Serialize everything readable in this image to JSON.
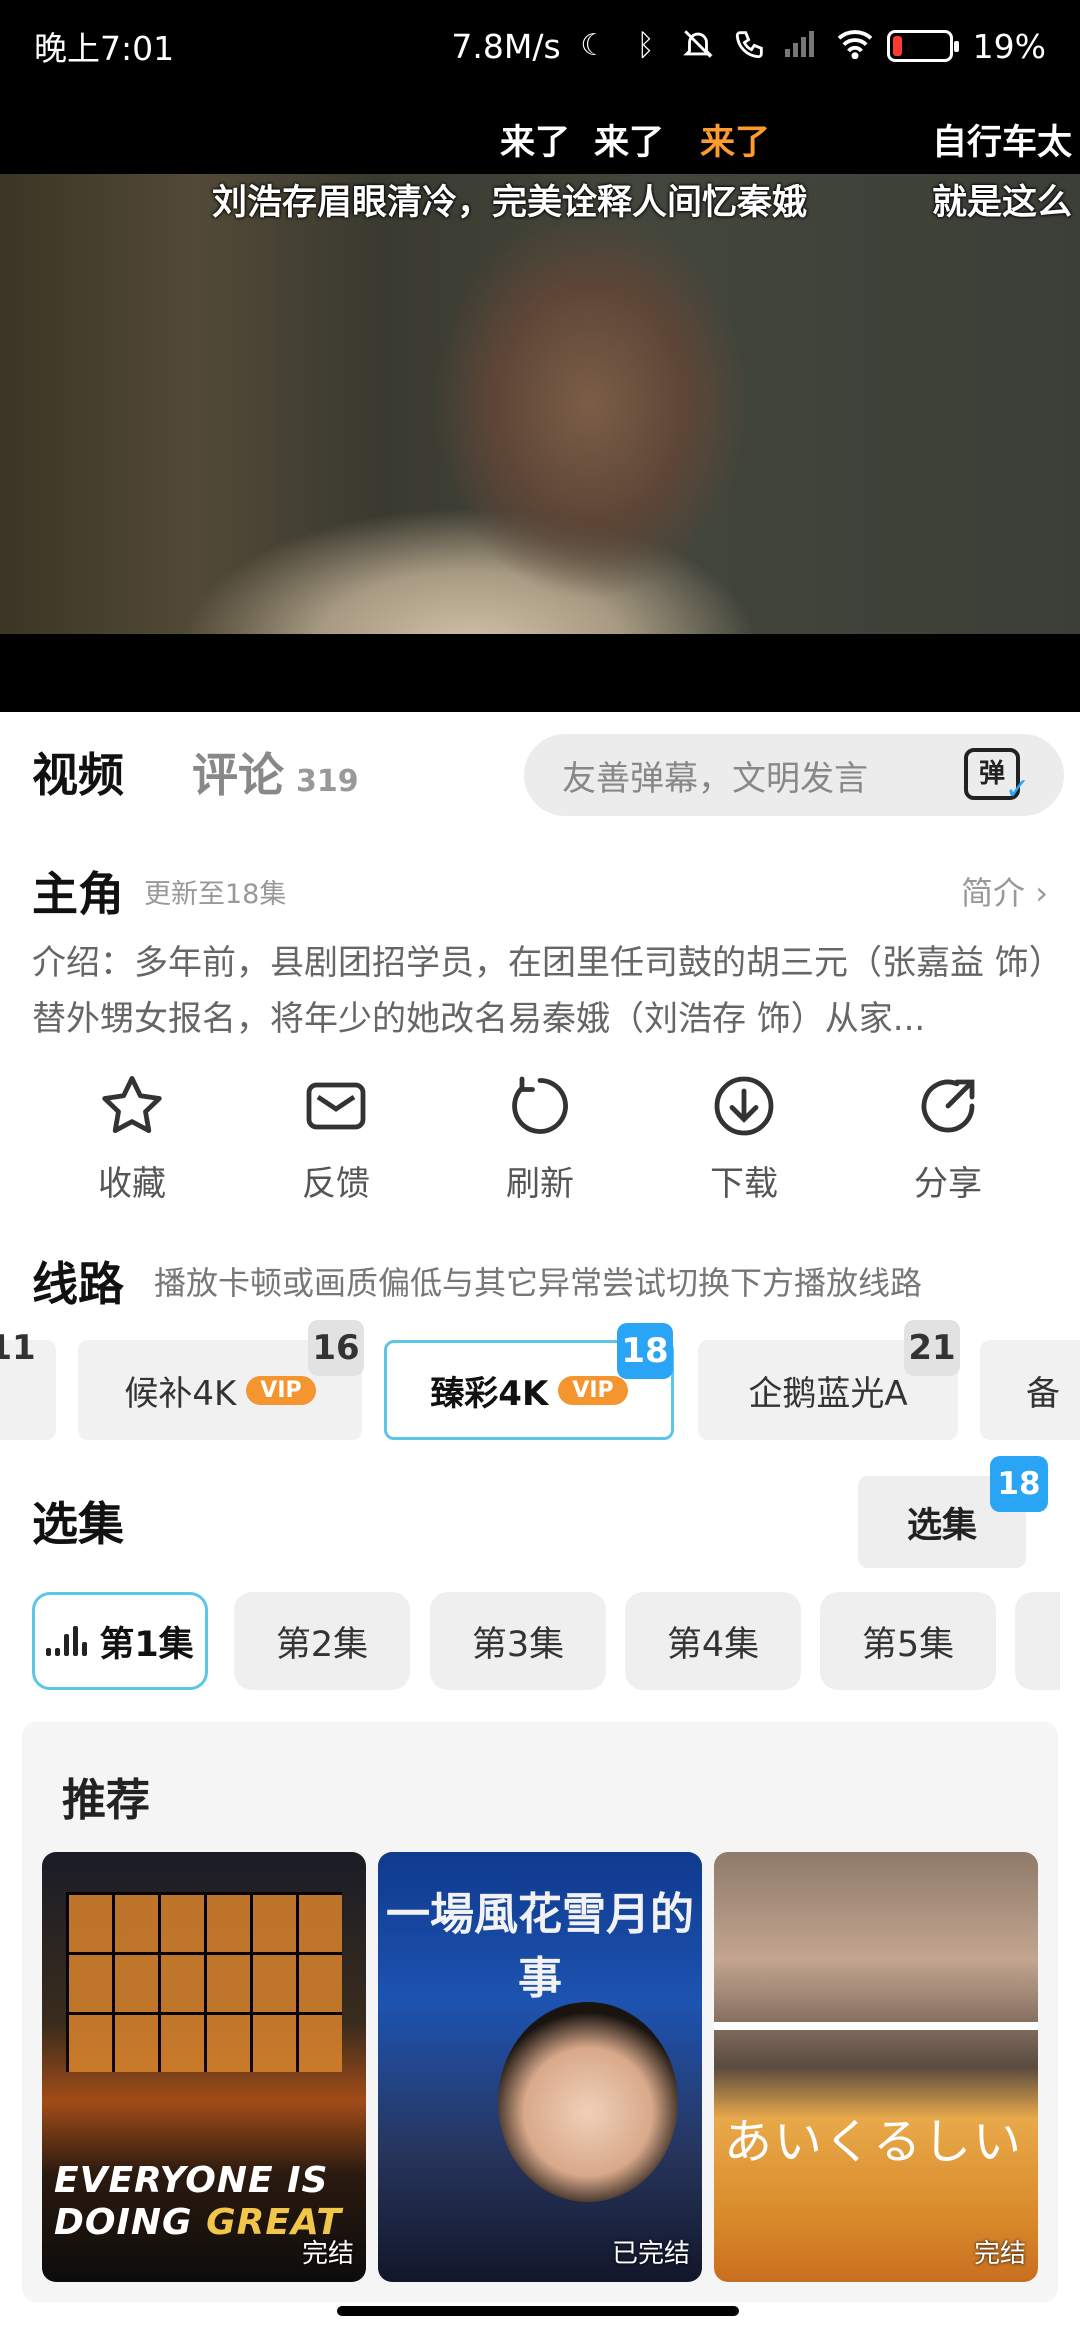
{
  "status_bar": {
    "time": "晚上7:01",
    "speed": "7.8M/s",
    "battery": "19%",
    "battery_level": 0.19,
    "icons": [
      "moon-icon",
      "bluetooth-icon",
      "mute-bell-icon",
      "call-icon",
      "signal-icon",
      "wifi-icon",
      "battery-icon"
    ]
  },
  "video": {
    "danmaku": [
      {
        "text": "来了",
        "highlight": false
      },
      {
        "text": "来了",
        "highlight": false
      },
      {
        "text": "来了",
        "highlight": true
      },
      {
        "text": "自行车太"
      },
      {
        "text": "刘浩存眉眼清冷，完美诠释人间忆秦娥"
      },
      {
        "text": "就是这么"
      }
    ]
  },
  "tabs": {
    "video": "视频",
    "comments": "评论",
    "comments_count": "319",
    "danmaku_placeholder": "友善弹幕，文明发言",
    "danmaku_button": "弹",
    "accent": "#2aa4f4"
  },
  "show": {
    "title": "主角",
    "update": "更新至18集",
    "intro_link": "简介",
    "description": "介绍：多年前，县剧团招学员，在团里任司鼓的胡三元（张嘉益 饰）替外甥女报名，将年少的她改名易秦娥（刘浩存 饰）从家..."
  },
  "actions": [
    {
      "label": "收藏",
      "icon": "star-icon"
    },
    {
      "label": "反馈",
      "icon": "mail-icon"
    },
    {
      "label": "刷新",
      "icon": "refresh-icon"
    },
    {
      "label": "下载",
      "icon": "download-icon"
    },
    {
      "label": "分享",
      "icon": "share-icon"
    }
  ],
  "routes": {
    "title": "线路",
    "tip": "播放卡顿或画质偏低与其它异常尝试切换下方播放线路",
    "items": [
      {
        "label": "",
        "badge": "11"
      },
      {
        "label": "候补4K",
        "vip": "VIP",
        "badge": "16"
      },
      {
        "label": "臻彩4K",
        "vip": "VIP",
        "badge": "18",
        "active": true
      },
      {
        "label": "企鹅蓝光A",
        "badge": "21"
      },
      {
        "label": "备"
      }
    ]
  },
  "episodes": {
    "title": "选集",
    "select_button": "选集",
    "select_badge": "18",
    "items": [
      "第1集",
      "第2集",
      "第3集",
      "第4集",
      "第5集"
    ],
    "active_index": 0
  },
  "recommend": {
    "title": "推荐",
    "posters": [
      {
        "title_art": "EVERYONE IS DOING GREAT",
        "line1": "EVERYONE IS",
        "line2a": "DOING ",
        "line2b": "GREAT",
        "tag": "完结"
      },
      {
        "title_art": "一場風花雪月的事",
        "tag": "已完结"
      },
      {
        "title_art": "あいくるしい",
        "tag": "完结"
      }
    ]
  }
}
